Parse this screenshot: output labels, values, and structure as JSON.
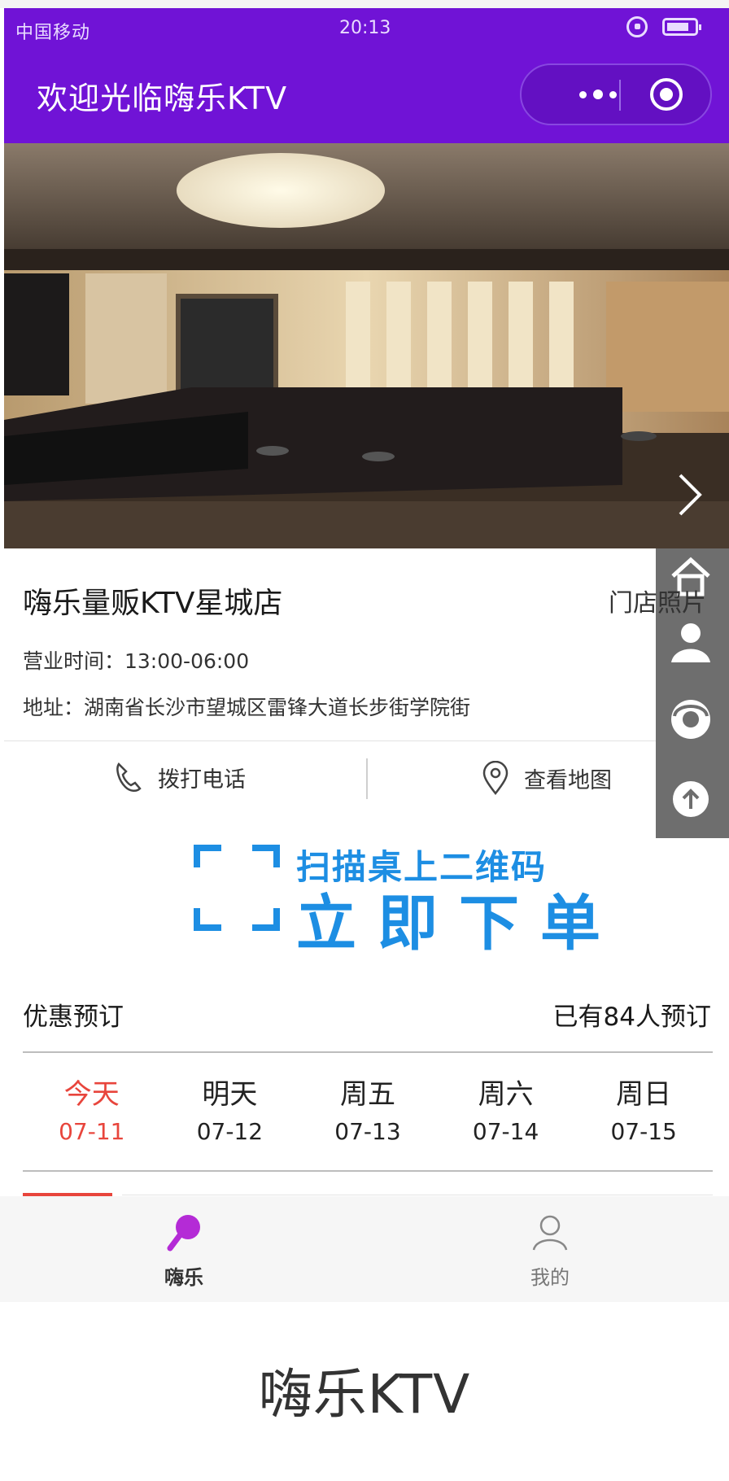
{
  "status_bar": {
    "signal": "中国移动",
    "time": "20:13"
  },
  "nav": {
    "title": "欢迎光临嗨乐KTV"
  },
  "store": {
    "name": "嗨乐量贩KTV星城店",
    "photos_link": "门店照片",
    "hours": "营业时间：13:00-06:00",
    "address": "地址：湖南省长沙市望城区雷锋大道长步街学院街",
    "call_label": "拨打电话",
    "map_label": "查看地图"
  },
  "scan_banner": {
    "line1": "扫描桌上二维码",
    "line2": "立即下单"
  },
  "booking": {
    "title": "优惠预订",
    "booked_count": "已有84人预订",
    "days": [
      {
        "name": "今天",
        "date": "07-11",
        "active": true
      },
      {
        "name": "明天",
        "date": "07-12",
        "active": false
      },
      {
        "name": "周五",
        "date": "07-13",
        "active": false
      },
      {
        "name": "周六",
        "date": "07-14",
        "active": false
      },
      {
        "name": "周日",
        "date": "07-15",
        "active": false
      }
    ]
  },
  "tabs": [
    {
      "label": "嗨乐",
      "icon": "microphone-icon",
      "selected": true
    },
    {
      "label": "我的",
      "icon": "person-icon",
      "selected": false
    }
  ],
  "sidebar_icons": [
    "home-icon",
    "person-icon",
    "customer-service-icon",
    "arrow-up-icon"
  ],
  "brand_footer": "嗨乐KTV",
  "colors": {
    "header": "#7013d6",
    "accent": "#e8453c",
    "scan_blue": "#1d8ee3",
    "tab_icon": "#b42bd6"
  }
}
